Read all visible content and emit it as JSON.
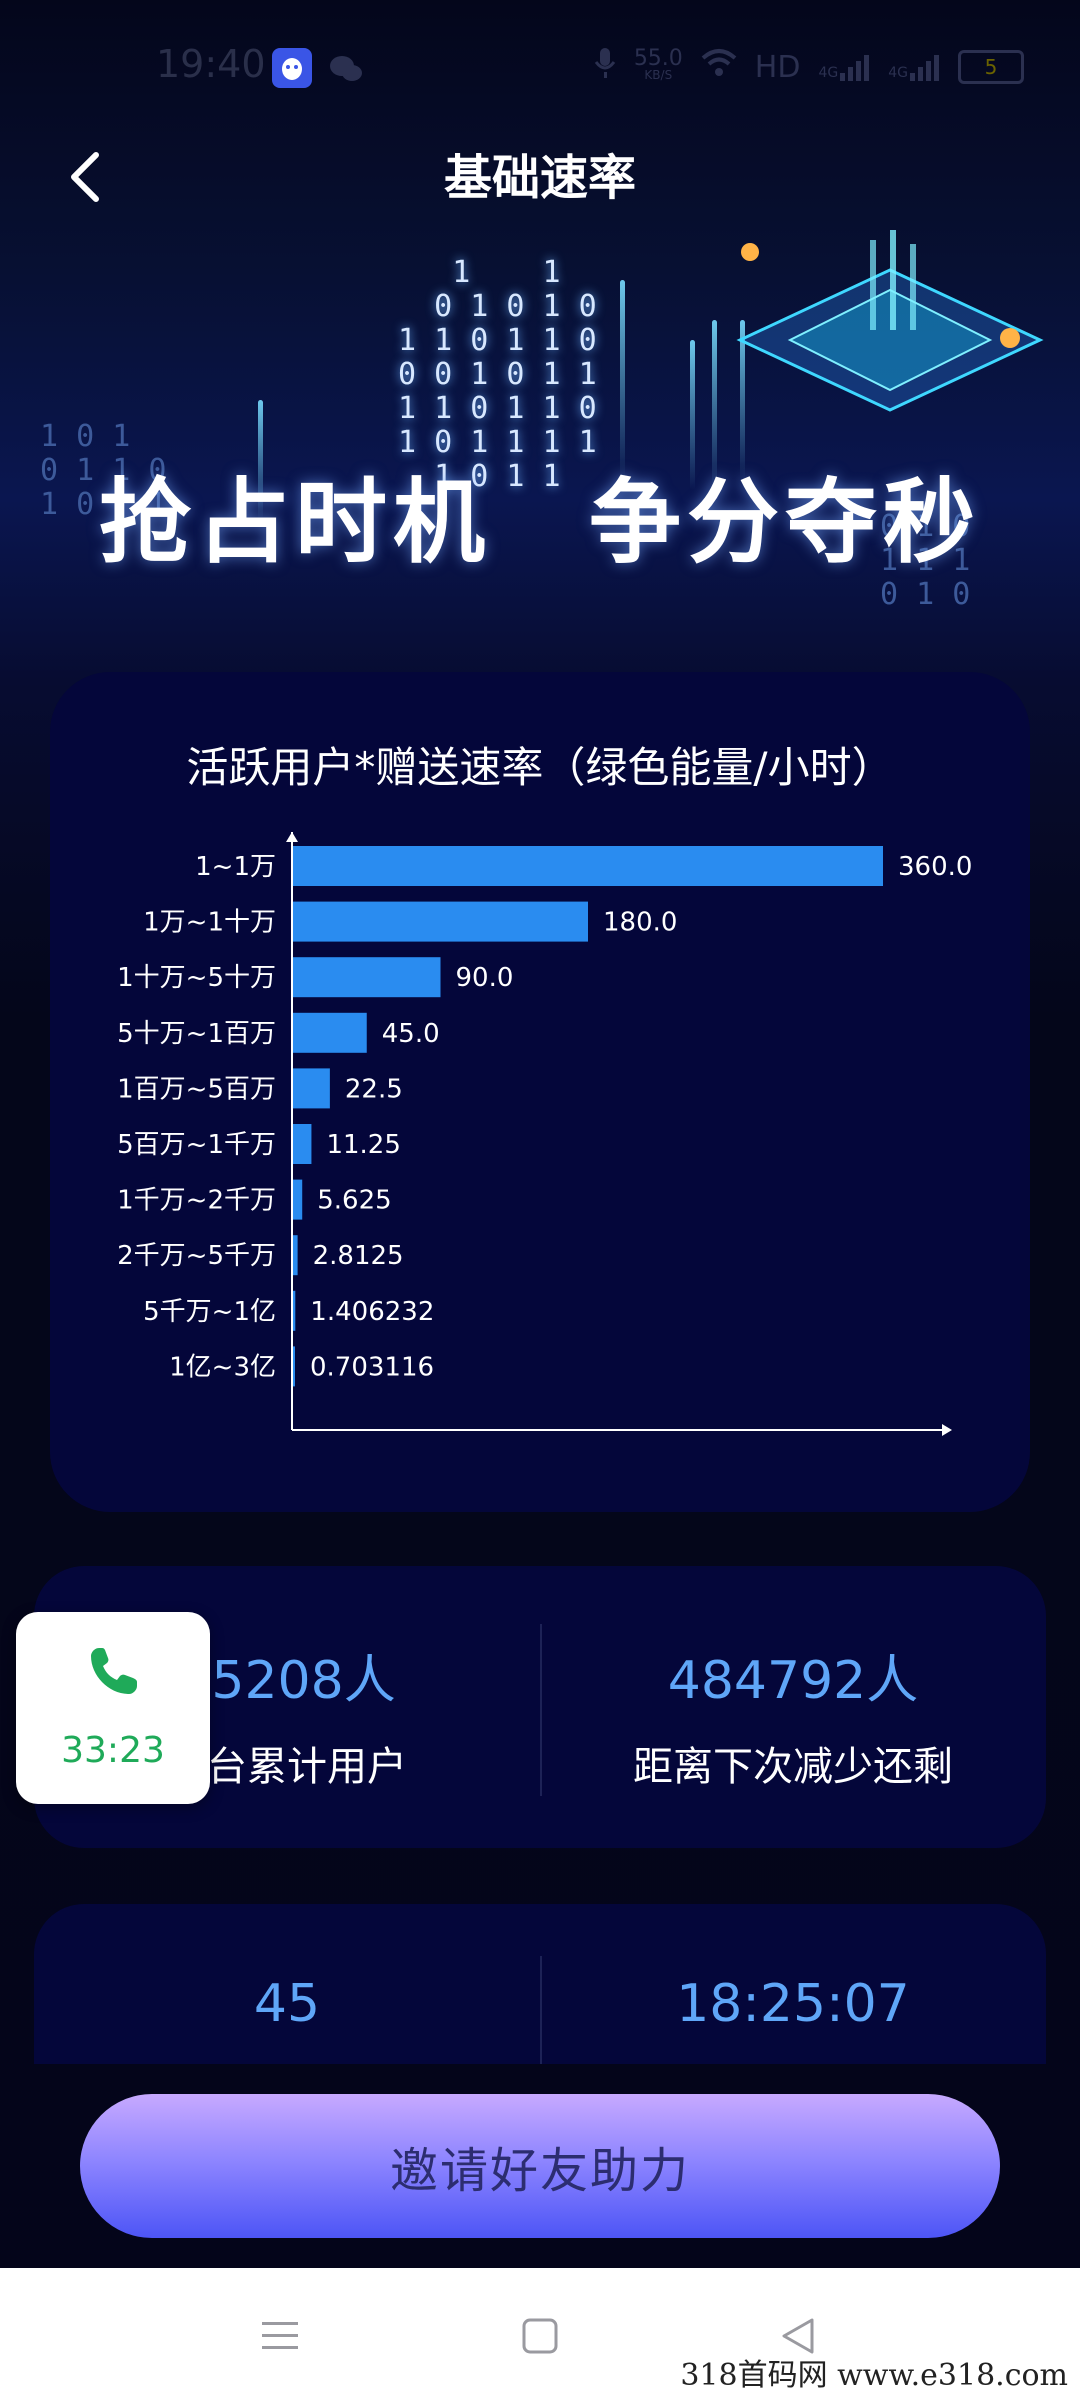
{
  "status_bar": {
    "time": "19:40",
    "network_speed": "55.0",
    "network_unit": "KB/S",
    "hd_label": "HD",
    "signal1": "4G",
    "signal2": "4G",
    "battery": "5"
  },
  "nav": {
    "title": "基础速率",
    "back_icon": "chevron-left-icon"
  },
  "hero": {
    "slogan": "抢占时机　争分夺秒"
  },
  "chart_card": {
    "title": "活跃用户*赠送速率（绿色能量/小时）"
  },
  "chart_data": {
    "type": "bar",
    "orientation": "horizontal",
    "categories": [
      "1~1万",
      "1万~1十万",
      "1十万~5十万",
      "5十万~1百万",
      "1百万~5百万",
      "5百万~1千万",
      "1千万~2千万",
      "2千万~5千万",
      "5千万~1亿",
      "1亿~3亿"
    ],
    "values": [
      360.0,
      180.0,
      90.0,
      45.0,
      22.5,
      11.25,
      5.625,
      2.8125,
      1.406232,
      0.703116
    ],
    "value_labels": [
      "360.0",
      "180.0",
      "90.0",
      "45.0",
      "22.5",
      "11.25",
      "5.625",
      "2.8125",
      "1.406232",
      "0.703116"
    ],
    "title": "活跃用户*赠送速率（绿色能量/小时）",
    "xlabel": "",
    "ylabel": "",
    "xlim": [
      0,
      360
    ],
    "grid": false,
    "bar_color": "#2a8cf0"
  },
  "stats": {
    "total_users_value": "15208人",
    "total_users_label": "平台累计用户",
    "remaining_value": "484792人",
    "remaining_label": "距离下次减少还剩",
    "second_left_value": "45",
    "second_right_value": "18:25:07"
  },
  "invite_button": {
    "label": "邀请好友助力"
  },
  "call_widget": {
    "time": "33:23",
    "icon": "phone-icon"
  },
  "system_nav": {
    "menu_icon": "menu-icon",
    "home_icon": "home-square-icon",
    "back_icon": "back-triangle-icon"
  },
  "watermark": "318首码网 www.e318.com",
  "colors": {
    "accent_blue": "#5fa6f8",
    "bar_blue": "#2a8cf0",
    "card_bg": "#04063a",
    "call_green": "#1faa59"
  }
}
